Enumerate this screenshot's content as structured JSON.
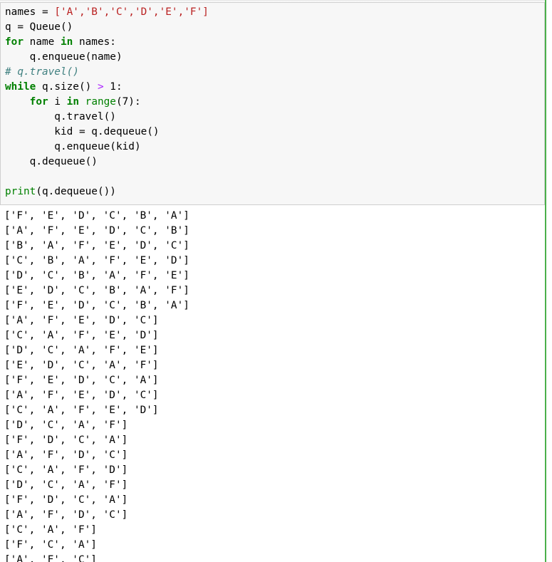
{
  "code": [
    {
      "segs": [
        {
          "t": "names = ",
          "c": ""
        },
        {
          "t": "['A','B','C','D','E','F']",
          "c": "str"
        }
      ]
    },
    {
      "segs": [
        {
          "t": "q = Queue()",
          "c": ""
        }
      ]
    },
    {
      "segs": [
        {
          "t": "for",
          "c": "kw"
        },
        {
          "t": " name ",
          "c": ""
        },
        {
          "t": "in",
          "c": "kw"
        },
        {
          "t": " names:",
          "c": ""
        }
      ]
    },
    {
      "segs": [
        {
          "t": "    q.enqueue(name)",
          "c": ""
        }
      ]
    },
    {
      "segs": [
        {
          "t": "# q.travel()",
          "c": "cm"
        }
      ]
    },
    {
      "segs": [
        {
          "t": "while",
          "c": "kw"
        },
        {
          "t": " q.size() ",
          "c": ""
        },
        {
          "t": ">",
          "c": "op"
        },
        {
          "t": " 1:",
          "c": ""
        }
      ]
    },
    {
      "segs": [
        {
          "t": "    ",
          "c": ""
        },
        {
          "t": "for",
          "c": "kw"
        },
        {
          "t": " i ",
          "c": ""
        },
        {
          "t": "in",
          "c": "kw"
        },
        {
          "t": " ",
          "c": ""
        },
        {
          "t": "range",
          "c": "builtin"
        },
        {
          "t": "(7):",
          "c": ""
        }
      ]
    },
    {
      "segs": [
        {
          "t": "        q.travel()",
          "c": ""
        }
      ]
    },
    {
      "segs": [
        {
          "t": "        kid = q.dequeue()",
          "c": ""
        }
      ]
    },
    {
      "segs": [
        {
          "t": "        q.enqueue(kid)",
          "c": ""
        }
      ]
    },
    {
      "segs": [
        {
          "t": "    q.dequeue()",
          "c": ""
        }
      ]
    },
    {
      "segs": [
        {
          "t": "",
          "c": ""
        }
      ]
    },
    {
      "segs": [
        {
          "t": "print",
          "c": "builtin"
        },
        {
          "t": "(q.dequeue())",
          "c": ""
        }
      ]
    }
  ],
  "output": [
    "['F', 'E', 'D', 'C', 'B', 'A']",
    "['A', 'F', 'E', 'D', 'C', 'B']",
    "['B', 'A', 'F', 'E', 'D', 'C']",
    "['C', 'B', 'A', 'F', 'E', 'D']",
    "['D', 'C', 'B', 'A', 'F', 'E']",
    "['E', 'D', 'C', 'B', 'A', 'F']",
    "['F', 'E', 'D', 'C', 'B', 'A']",
    "['A', 'F', 'E', 'D', 'C']",
    "['C', 'A', 'F', 'E', 'D']",
    "['D', 'C', 'A', 'F', 'E']",
    "['E', 'D', 'C', 'A', 'F']",
    "['F', 'E', 'D', 'C', 'A']",
    "['A', 'F', 'E', 'D', 'C']",
    "['C', 'A', 'F', 'E', 'D']",
    "['D', 'C', 'A', 'F']",
    "['F', 'D', 'C', 'A']",
    "['A', 'F', 'D', 'C']",
    "['C', 'A', 'F', 'D']",
    "['D', 'C', 'A', 'F']",
    "['F', 'D', 'C', 'A']",
    "['A', 'F', 'D', 'C']",
    "['C', 'A', 'F']",
    "['F', 'C', 'A']",
    "['A', 'F', 'C']"
  ]
}
